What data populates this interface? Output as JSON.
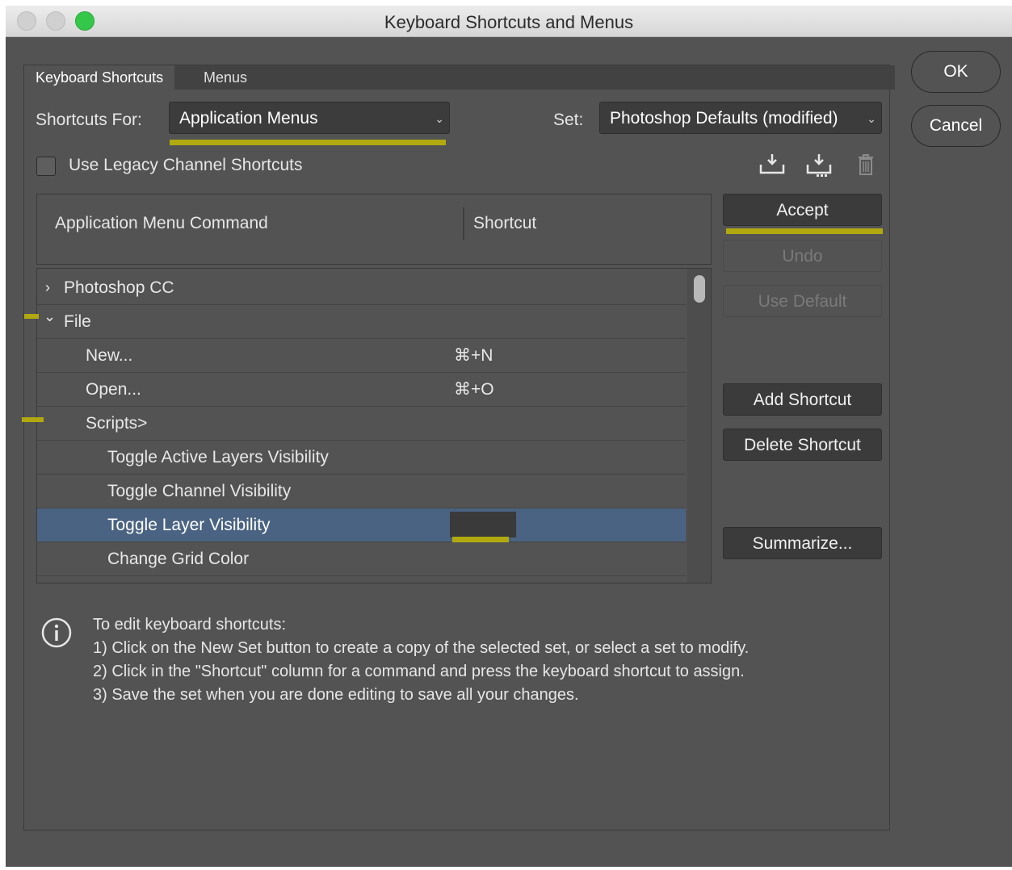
{
  "window": {
    "title": "Keyboard Shortcuts and Menus"
  },
  "tabs": [
    {
      "label": "Keyboard Shortcuts"
    },
    {
      "label": "Menus"
    }
  ],
  "shortcuts_for": {
    "label": "Shortcuts For:",
    "value": "Application Menus"
  },
  "set": {
    "label": "Set:",
    "value": "Photoshop Defaults (modified)"
  },
  "legacy_checkbox": {
    "label": "Use Legacy Channel Shortcuts",
    "checked": false
  },
  "toolbar_icons": [
    "save-set-icon",
    "new-set-icon",
    "trash-icon"
  ],
  "columns": {
    "command": "Application Menu Command",
    "shortcut": "Shortcut"
  },
  "rows": [
    {
      "label": "Photoshop CC",
      "shortcut": "",
      "expander": "›"
    },
    {
      "label": "File",
      "shortcut": "",
      "expander": "⌄"
    },
    {
      "label": "New...",
      "shortcut": "⌘+N"
    },
    {
      "label": "Open...",
      "shortcut": "⌘+O"
    },
    {
      "label": "Scripts>",
      "shortcut": ""
    },
    {
      "label": "Toggle Active Layers Visibility",
      "shortcut": ""
    },
    {
      "label": "Toggle Channel Visibility",
      "shortcut": ""
    },
    {
      "label": "Toggle Layer Visibility",
      "shortcut": "",
      "selected": true
    },
    {
      "label": "Change Grid Color",
      "shortcut": ""
    }
  ],
  "side_buttons": {
    "accept": "Accept",
    "undo": "Undo",
    "use_default": "Use Default",
    "add_shortcut": "Add Shortcut",
    "delete_shortcut": "Delete Shortcut",
    "summarize": "Summarize..."
  },
  "dialog_buttons": {
    "ok": "OK",
    "cancel": "Cancel"
  },
  "info": {
    "heading": "To edit keyboard shortcuts:",
    "step1": "1) Click on the New Set button to create a copy of the selected set, or select a set to modify.",
    "step2": "2) Click in the \"Shortcut\" column for a command and press the keyboard shortcut to assign.",
    "step3": "3) Save the set when you are done editing to save all your changes."
  },
  "colors": {
    "highlight": "#b1a90f",
    "selection": "#4a6382",
    "background": "#535353"
  }
}
